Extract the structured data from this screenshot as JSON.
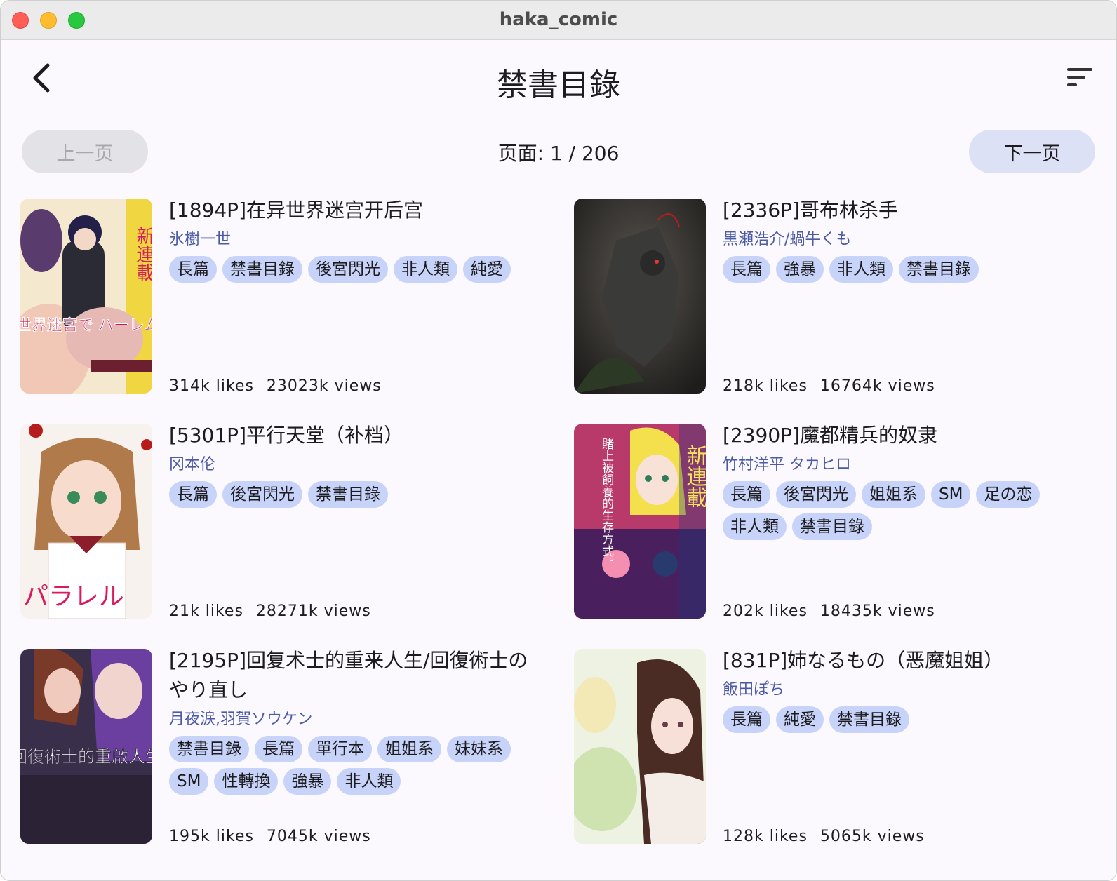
{
  "window": {
    "title": "haka_comic"
  },
  "appbar": {
    "title": "禁書目錄"
  },
  "pager": {
    "prev_label": "上一页",
    "next_label": "下一页",
    "indicator": "页面: 1 / 206"
  },
  "comics": [
    {
      "title": "[1894P]在异世界迷宫开后宫",
      "author": "氷樹一世",
      "tags": [
        "長篇",
        "禁書目錄",
        "後宮閃光",
        "非人類",
        "純愛"
      ],
      "likes": "314k likes",
      "views": "23023k views",
      "cover_text": "異世界迷宮で ハーレムを",
      "cover_badge": "新連載"
    },
    {
      "title": "[2336P]哥布林杀手",
      "author": "黒瀬浩介/蝸牛くも",
      "tags": [
        "長篇",
        "強暴",
        "非人類",
        "禁書目錄"
      ],
      "likes": "218k likes",
      "views": "16764k views"
    },
    {
      "title": "[5301P]平行天堂（补档）",
      "author": "冈本伦",
      "tags": [
        "長篇",
        "後宮閃光",
        "禁書目錄"
      ],
      "likes": "21k likes",
      "views": "28271k views",
      "cover_text": "パラレル"
    },
    {
      "title": "[2390P]魔都精兵的奴隶",
      "author": "竹村洋平  タカヒロ",
      "tags": [
        "長篇",
        "後宮閃光",
        "姐姐系",
        "SM",
        "足の恋",
        "非人類",
        "禁書目錄"
      ],
      "likes": "202k likes",
      "views": "18435k views",
      "cover_text": "賭上被飼養的生存方式。",
      "cover_badge": "新連載"
    },
    {
      "title": "[2195P]回复术士的重来人生/回復術士のやり直し",
      "author": "月夜涙,羽賀ソウケン",
      "tags": [
        "禁書目錄",
        "長篇",
        "單行本",
        "姐姐系",
        "妹妹系",
        "SM",
        "性轉換",
        "強暴",
        "非人類"
      ],
      "likes": "195k likes",
      "views": "7045k views",
      "cover_text": "回復術士的重啟人生"
    },
    {
      "title": "[831P]姉なるもの（恶魔姐姐）",
      "author": "飯田ぽち",
      "tags": [
        "長篇",
        "純愛",
        "禁書目錄"
      ],
      "likes": "128k likes",
      "views": "5065k views"
    }
  ]
}
